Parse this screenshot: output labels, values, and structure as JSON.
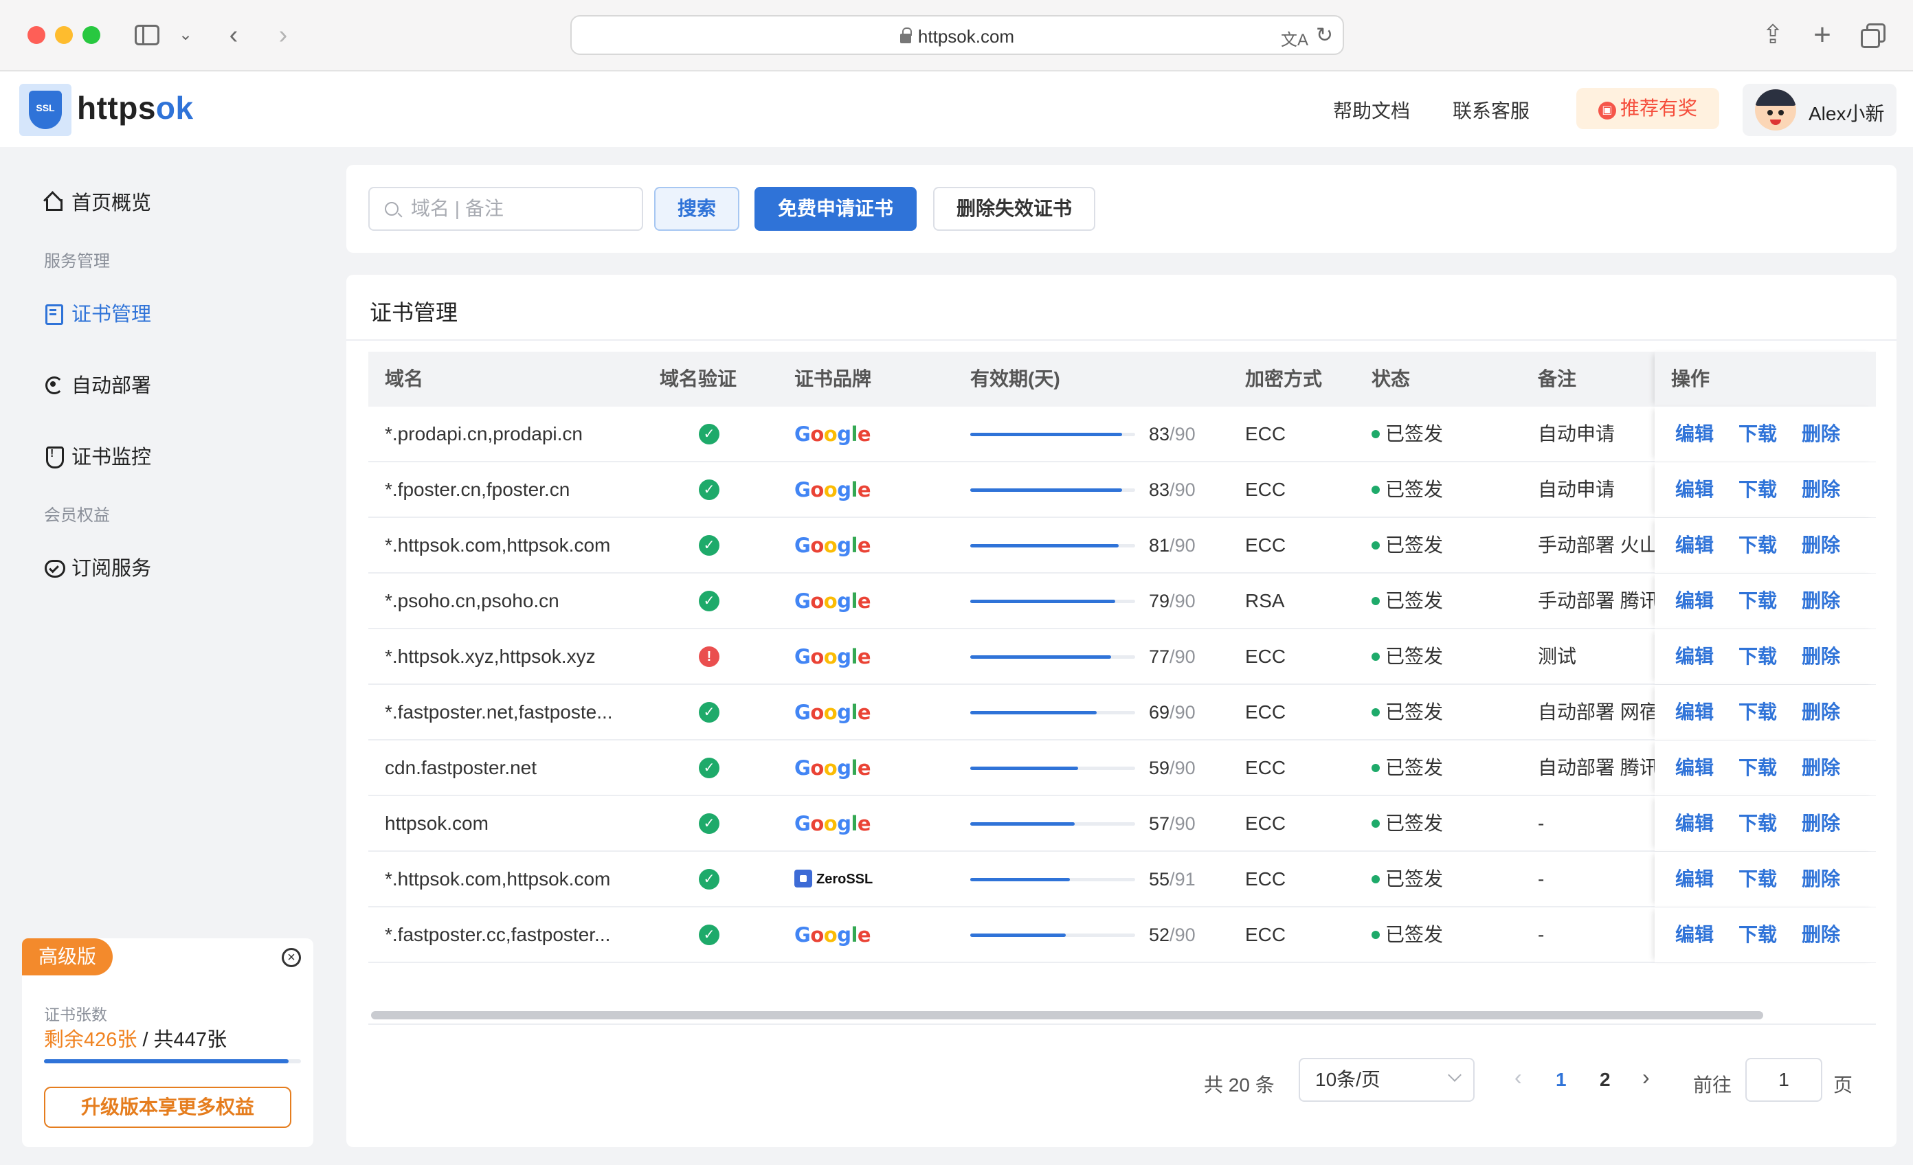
{
  "browser": {
    "url": "httpsok.com"
  },
  "header": {
    "brand_main": "httpsok",
    "brand_main_part": "https",
    "brand_accent_part": "ok",
    "logo_badge_text": "SSL",
    "help_label": "帮助文档",
    "contact_label": "联系客服",
    "referral_label": "推荐有奖",
    "user_name": "Alex小新"
  },
  "sidebar": {
    "items": [
      {
        "label": "首页概览",
        "icon": "home-icon",
        "active": false
      },
      {
        "label": "证书管理",
        "icon": "certificate-icon",
        "active": true
      },
      {
        "label": "自动部署",
        "icon": "deploy-icon",
        "active": false
      },
      {
        "label": "证书监控",
        "icon": "monitor-icon",
        "active": false
      },
      {
        "label": "订阅服务",
        "icon": "subscription-icon",
        "active": false
      }
    ],
    "groups": {
      "service": "服务管理",
      "member": "会员权益"
    },
    "plan": {
      "tag": "高级版",
      "count_label": "证书张数",
      "remaining_text": "剩余426张",
      "total_text": " / 共447张",
      "remaining": 426,
      "total": 447,
      "upgrade_label": "升级版本享更多权益"
    }
  },
  "toolbar": {
    "search_placeholder": "域名 | 备注",
    "search_value": "",
    "search_label": "搜索",
    "apply_label": "免费申请证书",
    "clean_label": "删除失效证书"
  },
  "main": {
    "title": "证书管理",
    "columns": [
      "域名",
      "域名验证",
      "证书品牌",
      "有效期(天)",
      "加密方式",
      "状态",
      "备注",
      "操作"
    ],
    "actions": {
      "edit": "编辑",
      "download": "下载",
      "delete": "删除"
    },
    "rows": [
      {
        "domain": "*.prodapi.cn,prodapi.cn",
        "verified": true,
        "brand": "Google",
        "days": 83,
        "total": 90,
        "encryption": "ECC",
        "status": "已签发",
        "note": "自动申请"
      },
      {
        "domain": "*.fposter.cn,fposter.cn",
        "verified": true,
        "brand": "Google",
        "days": 83,
        "total": 90,
        "encryption": "ECC",
        "status": "已签发",
        "note": "自动申请"
      },
      {
        "domain": "*.httpsok.com,httpsok.com",
        "verified": true,
        "brand": "Google",
        "days": 81,
        "total": 90,
        "encryption": "ECC",
        "status": "已签发",
        "note": "手动部署 火山"
      },
      {
        "domain": "*.psoho.cn,psoho.cn",
        "verified": true,
        "brand": "Google",
        "days": 79,
        "total": 90,
        "encryption": "RSA",
        "status": "已签发",
        "note": "手动部署 腾讯"
      },
      {
        "domain": "*.httpsok.xyz,httpsok.xyz",
        "verified": false,
        "brand": "Google",
        "days": 77,
        "total": 90,
        "encryption": "ECC",
        "status": "已签发",
        "note": "测试"
      },
      {
        "domain": "*.fastposter.net,fastposte...",
        "verified": true,
        "brand": "Google",
        "days": 69,
        "total": 90,
        "encryption": "ECC",
        "status": "已签发",
        "note": "自动部署 网宿"
      },
      {
        "domain": "cdn.fastposter.net",
        "verified": true,
        "brand": "Google",
        "days": 59,
        "total": 90,
        "encryption": "ECC",
        "status": "已签发",
        "note": "自动部署 腾讯"
      },
      {
        "domain": "httpsok.com",
        "verified": true,
        "brand": "Google",
        "days": 57,
        "total": 90,
        "encryption": "ECC",
        "status": "已签发",
        "note": "-"
      },
      {
        "domain": "*.httpsok.com,httpsok.com",
        "verified": true,
        "brand": "ZeroSSL",
        "days": 55,
        "total": 91,
        "encryption": "ECC",
        "status": "已签发",
        "note": "-"
      },
      {
        "domain": "*.fastposter.cc,fastposter...",
        "verified": true,
        "brand": "Google",
        "days": 52,
        "total": 90,
        "encryption": "ECC",
        "status": "已签发",
        "note": "-"
      }
    ]
  },
  "pagination": {
    "total_text": "共 20 条",
    "page_size": "10条/页",
    "pages": [
      "1",
      "2"
    ],
    "current_page": "1",
    "goto_label": "前往",
    "goto_value": "1",
    "unit_label": "页"
  },
  "colors": {
    "primary": "#2f73d8",
    "success": "#1eaa6a",
    "danger": "#ea4f4f",
    "orange": "#f38a2c"
  }
}
